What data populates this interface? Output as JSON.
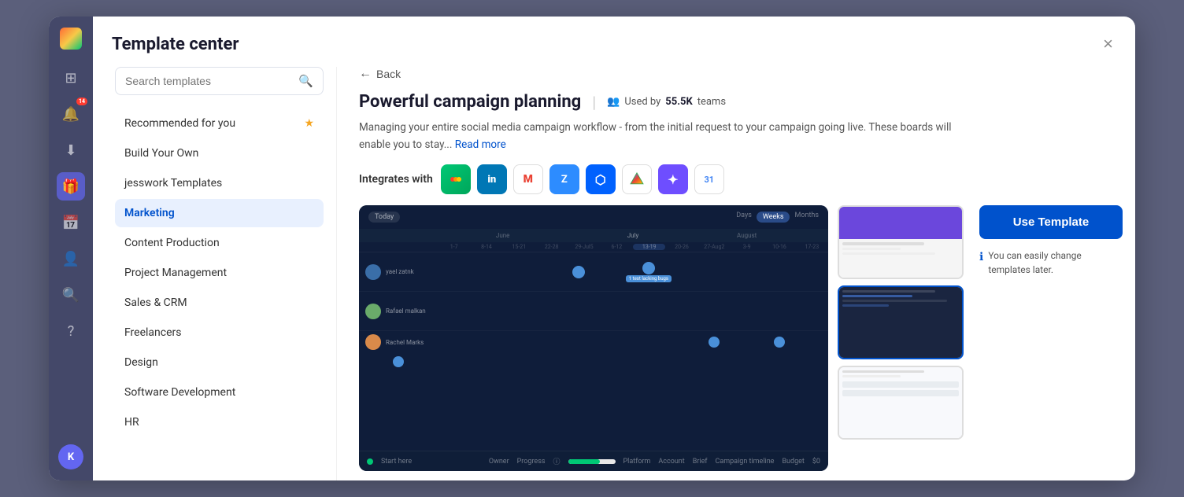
{
  "app": {
    "title": "Template center",
    "close_label": "×",
    "logo_letter": "K"
  },
  "sidebar_nav": {
    "items": [
      {
        "id": "recommended",
        "label": "Recommended for you",
        "has_star": true,
        "active": false
      },
      {
        "id": "build",
        "label": "Build Your Own",
        "has_star": false,
        "active": false
      },
      {
        "id": "jesswork",
        "label": "jesswork Templates",
        "has_star": false,
        "active": false
      },
      {
        "id": "marketing",
        "label": "Marketing",
        "has_star": false,
        "active": true
      },
      {
        "id": "content",
        "label": "Content Production",
        "has_star": false,
        "active": false
      },
      {
        "id": "project",
        "label": "Project Management",
        "has_star": false,
        "active": false
      },
      {
        "id": "sales",
        "label": "Sales & CRM",
        "has_star": false,
        "active": false
      },
      {
        "id": "freelancers",
        "label": "Freelancers",
        "has_star": false,
        "active": false
      },
      {
        "id": "design",
        "label": "Design",
        "has_star": false,
        "active": false
      },
      {
        "id": "software",
        "label": "Software Development",
        "has_star": false,
        "active": false
      },
      {
        "id": "hr",
        "label": "HR",
        "has_star": false,
        "active": false
      }
    ]
  },
  "search": {
    "placeholder": "Search templates"
  },
  "template": {
    "title": "Powerful campaign planning",
    "divider": "|",
    "usage_icon": "👥",
    "usage_text": "Used by",
    "usage_count": "55.5K",
    "usage_suffix": "teams",
    "description": "Managing your entire social media campaign workflow - from the initial request to your campaign going live. These boards will enable you to stay...",
    "read_more": "Read more",
    "integrates_label": "Integrates with",
    "use_template_label": "Use Template",
    "change_note": "You can easily change templates later.",
    "back_label": "Back"
  },
  "integrations": [
    {
      "id": "monday",
      "label": "monday",
      "symbol": "◆"
    },
    {
      "id": "linkedin",
      "label": "LinkedIn",
      "symbol": "in"
    },
    {
      "id": "gmail",
      "label": "Gmail",
      "symbol": "M"
    },
    {
      "id": "zoom",
      "label": "Zoom",
      "symbol": "Z"
    },
    {
      "id": "dropbox",
      "label": "Dropbox",
      "symbol": "⬡"
    },
    {
      "id": "gdrive",
      "label": "Google Drive",
      "symbol": "▲"
    },
    {
      "id": "custom",
      "label": "Custom",
      "symbol": "✦"
    },
    {
      "id": "calendar",
      "label": "Calendar",
      "symbol": "31"
    }
  ],
  "gantt": {
    "view_options": [
      "Today",
      "Days",
      "Weeks",
      "Months"
    ],
    "active_view": "Weeks",
    "months": [
      "June",
      "",
      "",
      "",
      "",
      "July",
      "",
      "",
      "",
      "",
      "August",
      "",
      ""
    ],
    "rows": [
      {
        "name": "yael zatnk",
        "color": "#4a90d9"
      },
      {
        "name": "Rafael malkan",
        "color": "#4a90d9"
      },
      {
        "name": "Rachel Marks",
        "color": "#4a90d9"
      }
    ]
  },
  "bottom_bar": {
    "start_label": "Start here",
    "columns": [
      "Owner",
      "Progress",
      "ⓘ",
      "Platform",
      "Account",
      "Brief",
      "Campaign timeline",
      "Budget"
    ],
    "progress_value": 67
  },
  "app_nav": {
    "icons": [
      {
        "id": "grid",
        "symbol": "⊞",
        "active": false
      },
      {
        "id": "bell",
        "symbol": "🔔",
        "active": false,
        "badge": "14"
      },
      {
        "id": "download",
        "symbol": "⬇",
        "active": false
      },
      {
        "id": "gift",
        "symbol": "🎁",
        "active": true
      },
      {
        "id": "calendar2",
        "symbol": "📅",
        "active": false
      },
      {
        "id": "person",
        "symbol": "👤",
        "active": false
      },
      {
        "id": "search2",
        "symbol": "🔍",
        "active": false
      },
      {
        "id": "question",
        "symbol": "?",
        "active": false
      }
    ]
  }
}
